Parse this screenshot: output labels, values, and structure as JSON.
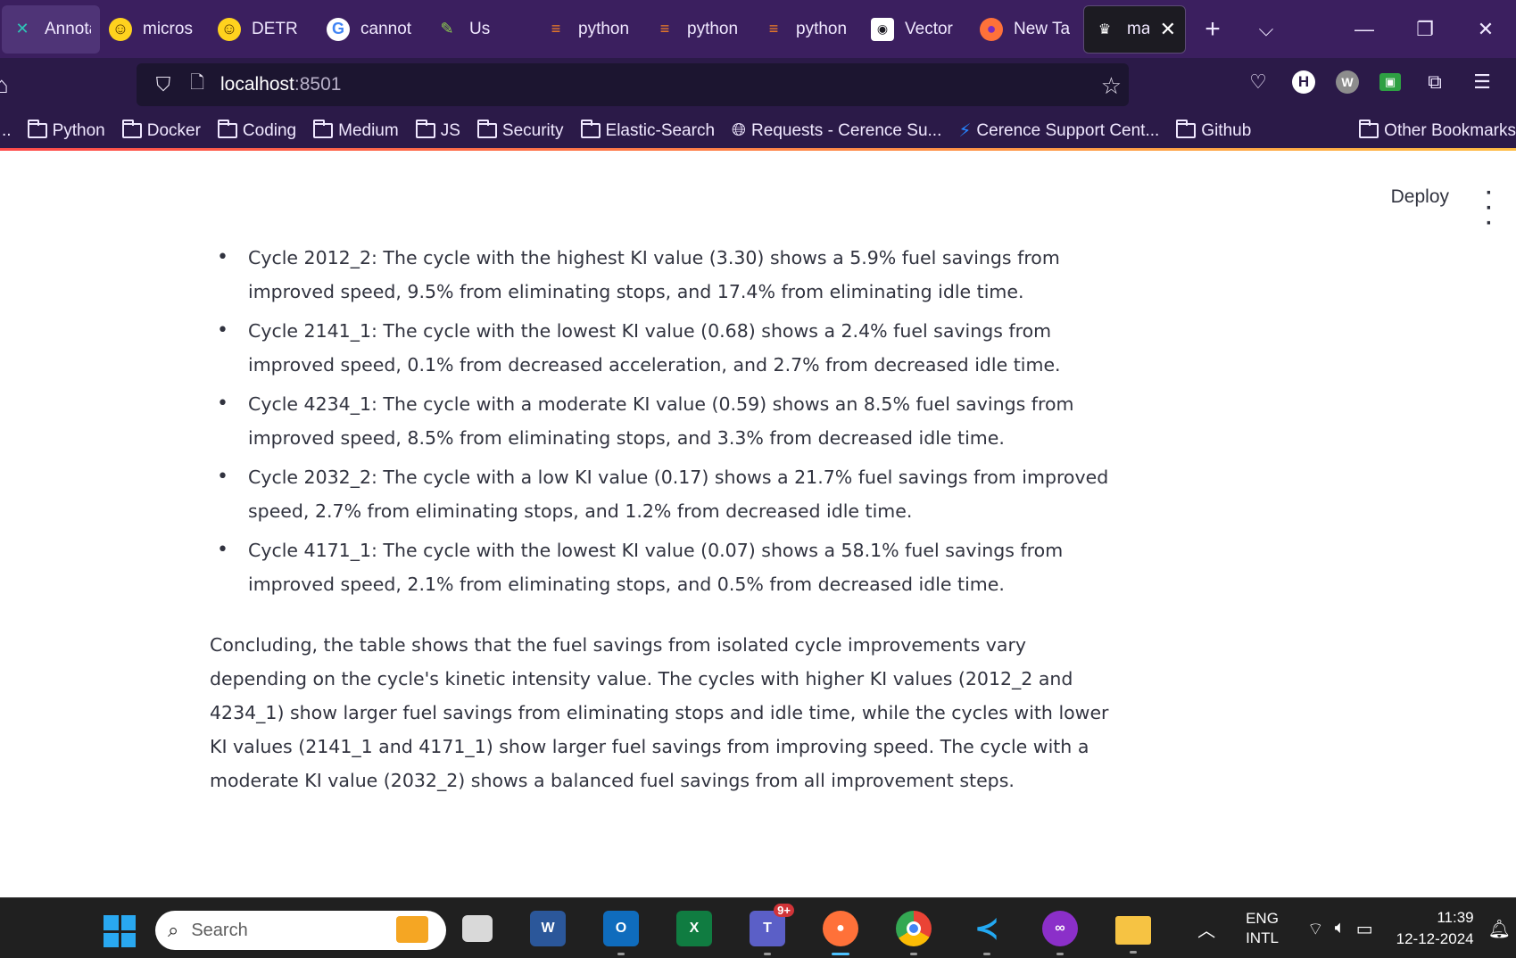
{
  "browser": {
    "tabs": [
      {
        "label": "Annota",
        "icon": "annotate-icon"
      },
      {
        "label": "micros",
        "icon": "huggingface-icon"
      },
      {
        "label": "DETR",
        "icon": "huggingface-icon"
      },
      {
        "label": "cannot",
        "icon": "google-icon"
      },
      {
        "label": "Us",
        "icon": "extension-icon"
      },
      {
        "label": "python",
        "icon": "stackoverflow-icon"
      },
      {
        "label": "python",
        "icon": "stackoverflow-icon"
      },
      {
        "label": "python",
        "icon": "stackoverflow-icon"
      },
      {
        "label": "Vector",
        "icon": "vector-icon"
      },
      {
        "label": "New Ta",
        "icon": "firefox-icon"
      },
      {
        "label": "mai",
        "icon": "streamlit-icon",
        "active": true
      }
    ],
    "url": "localhost",
    "port": ":8501",
    "bookmarks": [
      "Python",
      "Docker",
      "Coding",
      "Medium",
      "JS",
      "Security",
      "Elastic-Search",
      "Requests - Cerence Su...",
      "Cerence Support Cent...",
      "Github"
    ],
    "other_bookmarks": "Other Bookmarks",
    "ext_h": "H",
    "ext_w": "W"
  },
  "app": {
    "deploy_label": "Deploy",
    "cycles": [
      "Cycle 2012_2: The cycle with the highest KI value (3.30) shows a 5.9% fuel savings from improved speed, 9.5% from eliminating stops, and 17.4% from eliminating idle time.",
      "Cycle 2141_1: The cycle with the lowest KI value (0.68) shows a 2.4% fuel savings from improved speed, 0.1% from decreased acceleration, and 2.7% from decreased idle time.",
      "Cycle 4234_1: The cycle with a moderate KI value (0.59) shows an 8.5% fuel savings from improved speed, 8.5% from eliminating stops, and 3.3% from decreased idle time.",
      "Cycle 2032_2: The cycle with a low KI value (0.17) shows a 21.7% fuel savings from improved speed, 2.7% from eliminating stops, and 1.2% from decreased idle time.",
      "Cycle 4171_1: The cycle with the lowest KI value (0.07) shows a 58.1% fuel savings from improved speed, 2.1% from eliminating stops, and 0.5% from decreased idle time."
    ],
    "conclusion": "Concluding, the table shows that the fuel savings from isolated cycle improvements vary depending on the cycle's kinetic intensity value. The cycles with higher KI values (2012_2 and 4234_1) show larger fuel savings from eliminating stops and idle time, while the cycles with lower KI values (2141_1 and 4171_1) show larger fuel savings from improving speed. The cycle with a moderate KI value (2032_2) shows a balanced fuel savings from all improvement steps."
  },
  "taskbar": {
    "search_placeholder": "Search",
    "teams_badge": "9+",
    "lang_1": "ENG",
    "lang_2": "INTL",
    "time": "11:39",
    "date": "12-12-2024"
  },
  "colors": {
    "tab_bg": "#3b1f5f",
    "toolbar_bg": "#2b1a48",
    "text": "#31333f",
    "taskbar_bg": "#202020"
  }
}
